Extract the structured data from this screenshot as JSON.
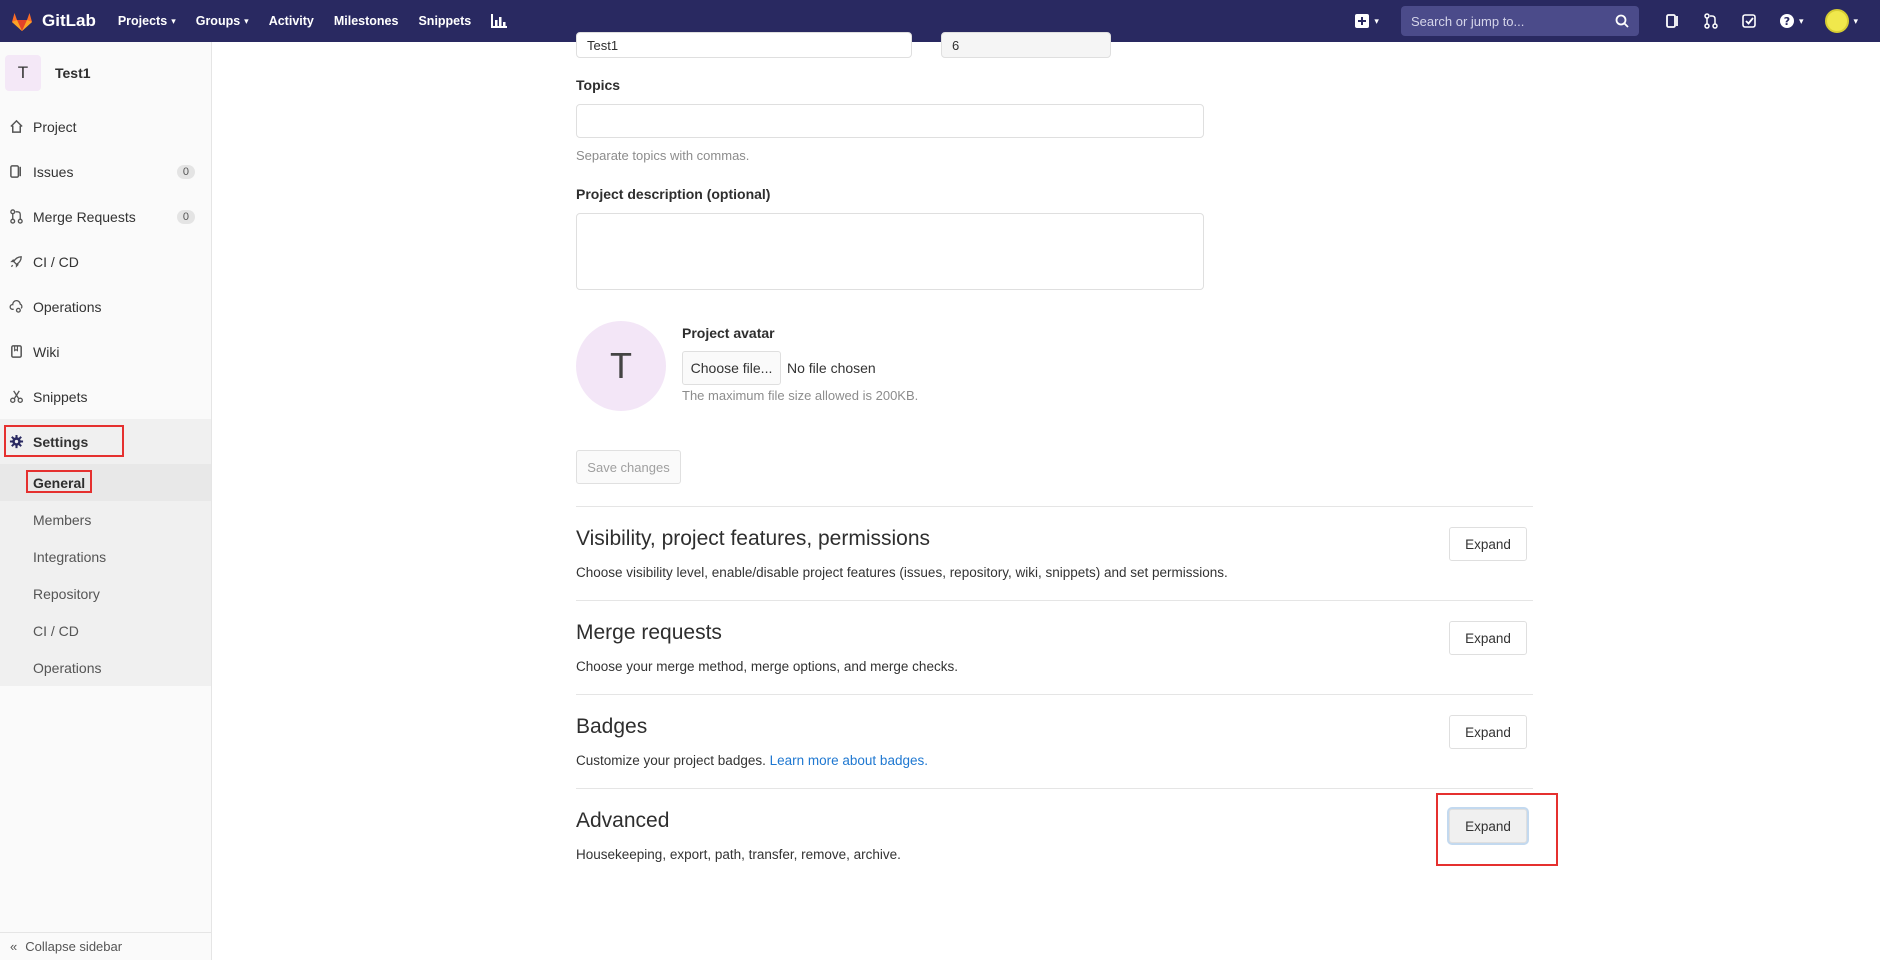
{
  "navbar": {
    "brand": "GitLab",
    "links": [
      "Projects",
      "Groups",
      "Activity",
      "Milestones",
      "Snippets"
    ],
    "search_placeholder": "Search or jump to..."
  },
  "sidebar": {
    "project_letter": "T",
    "project_name": "Test1",
    "items": [
      {
        "label": "Project",
        "icon": "home-icon"
      },
      {
        "label": "Issues",
        "icon": "issues-icon",
        "count": "0"
      },
      {
        "label": "Merge Requests",
        "icon": "merge-request-icon",
        "count": "0"
      },
      {
        "label": "CI / CD",
        "icon": "rocket-icon"
      },
      {
        "label": "Operations",
        "icon": "cloud-gear-icon"
      },
      {
        "label": "Wiki",
        "icon": "book-icon"
      },
      {
        "label": "Snippets",
        "icon": "scissors-icon"
      }
    ],
    "settings_label": "Settings",
    "settings_sub": [
      "General",
      "Members",
      "Integrations",
      "Repository",
      "CI / CD",
      "Operations"
    ],
    "collapse_label": "Collapse sidebar"
  },
  "form": {
    "project_name_value": "Test1",
    "project_id_value": "6",
    "topics_label": "Topics",
    "topics_help": "Separate topics with commas.",
    "description_label": "Project description (optional)",
    "avatar_letter": "T",
    "avatar_label": "Project avatar",
    "choose_file": "Choose file...",
    "no_file": "No file chosen",
    "file_help": "The maximum file size allowed is 200KB.",
    "save_button": "Save changes"
  },
  "sections": [
    {
      "title": "Visibility, project features, permissions",
      "desc": "Choose visibility level, enable/disable project features (issues, repository, wiki, snippets) and set permissions.",
      "button": "Expand"
    },
    {
      "title": "Merge requests",
      "desc": "Choose your merge method, merge options, and merge checks.",
      "button": "Expand"
    },
    {
      "title": "Badges",
      "desc": "Customize your project badges.",
      "link": "Learn more about badges.",
      "button": "Expand"
    },
    {
      "title": "Advanced",
      "desc": "Housekeeping, export, path, transfer, remove, archive.",
      "button": "Expand"
    }
  ]
}
